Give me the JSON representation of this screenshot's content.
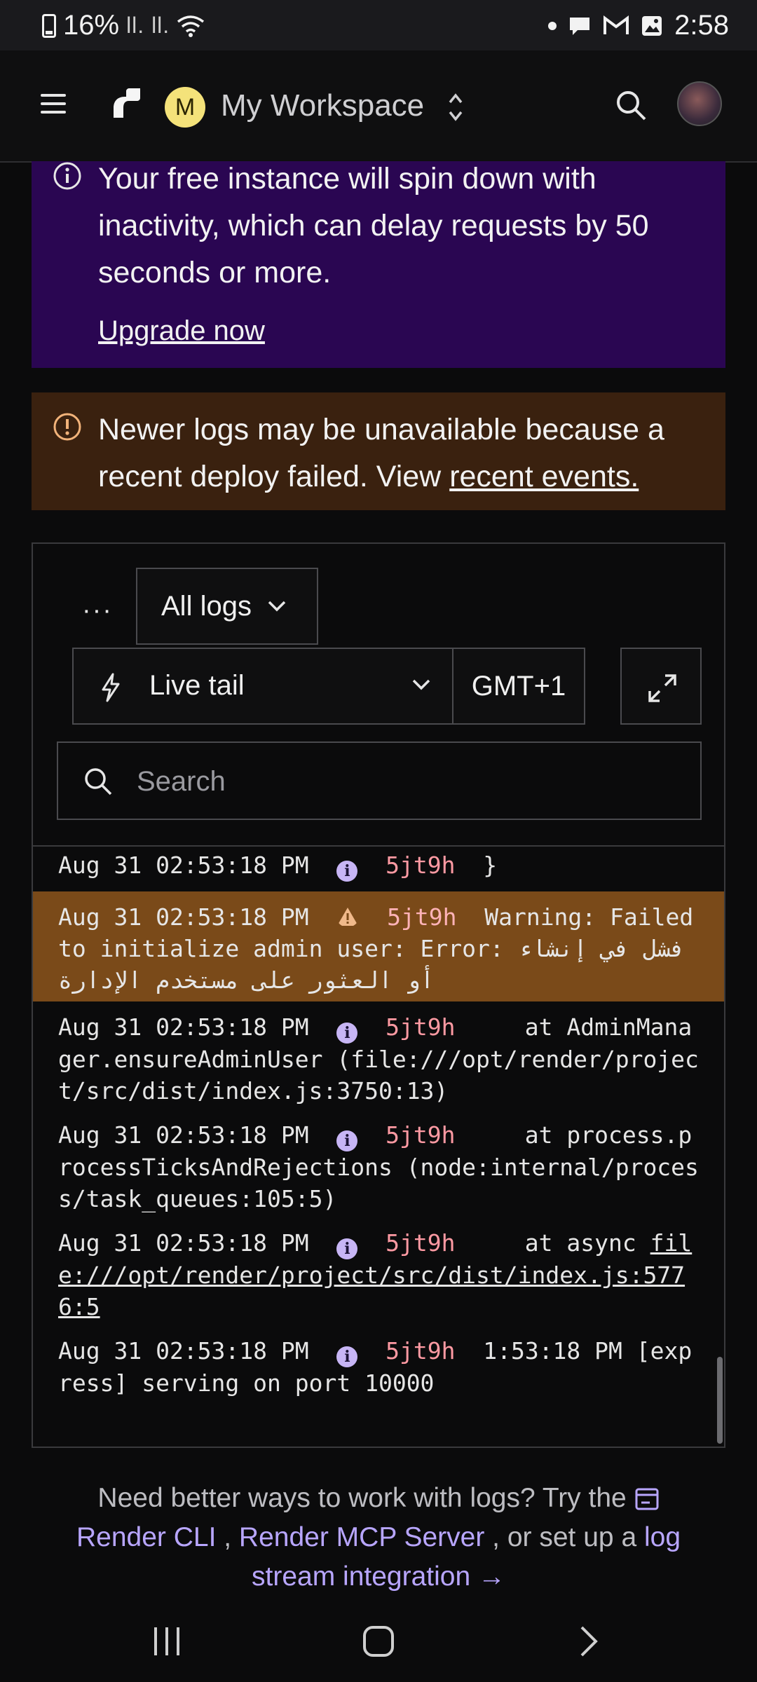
{
  "status_bar": {
    "battery": "16%",
    "signal": "ll. ll.",
    "time": "2:58"
  },
  "header": {
    "workspace_initial": "M",
    "workspace_name": "My Workspace"
  },
  "free_banner": {
    "message": "Your free instance will spin down with inactivity, which can delay requests by 50 seconds or more.",
    "link": "Upgrade now"
  },
  "deploy_banner": {
    "message": "Newer logs may be unavailable because a recent deploy failed. View ",
    "link": "recent events."
  },
  "log_controls": {
    "more": "···",
    "filter": "All logs",
    "mode": "Live tail",
    "timezone": "GMT+1",
    "search_placeholder": "Search"
  },
  "logs": [
    {
      "ts": "Aug 31 02:53:18 PM",
      "level": "info",
      "instance": "5jt9h",
      "msg": "}"
    },
    {
      "ts": "Aug 31 02:53:18 PM",
      "level": "warning",
      "instance": "5jt9h",
      "msg": "Warning: Failed to initialize admin user: Error: فشل في إنشاء أو العثور على مستخدم الإدارة"
    },
    {
      "ts": "Aug 31 02:53:18 PM",
      "level": "info",
      "instance": "5jt9h",
      "msg": "     at AdminManager.ensureAdminUser (file:///opt/render/project/src/dist/index.js:3750:13)"
    },
    {
      "ts": "Aug 31 02:53:18 PM",
      "level": "info",
      "instance": "5jt9h",
      "msg": "     at process.processTicksAndRejections (node:internal/process/task_queues:105:5)"
    },
    {
      "ts": "Aug 31 02:53:18 PM",
      "level": "info",
      "instance": "5jt9h",
      "msg_prefix": "     at async ",
      "msg_link": "file:///opt/render/project/src/dist/index.js:5776:5"
    },
    {
      "ts": "Aug 31 02:53:18 PM",
      "level": "info",
      "instance": "5jt9h",
      "msg": "1:53:18 PM [express] serving on port 10000"
    }
  ],
  "footer": {
    "text1": "Need better ways to work with logs? Try the",
    "link_cli": "Render CLI",
    "sep": " , ",
    "link_mcp": "Render MCP Server",
    "text2": " , or set up a ",
    "link_stream": "log stream integration →"
  }
}
